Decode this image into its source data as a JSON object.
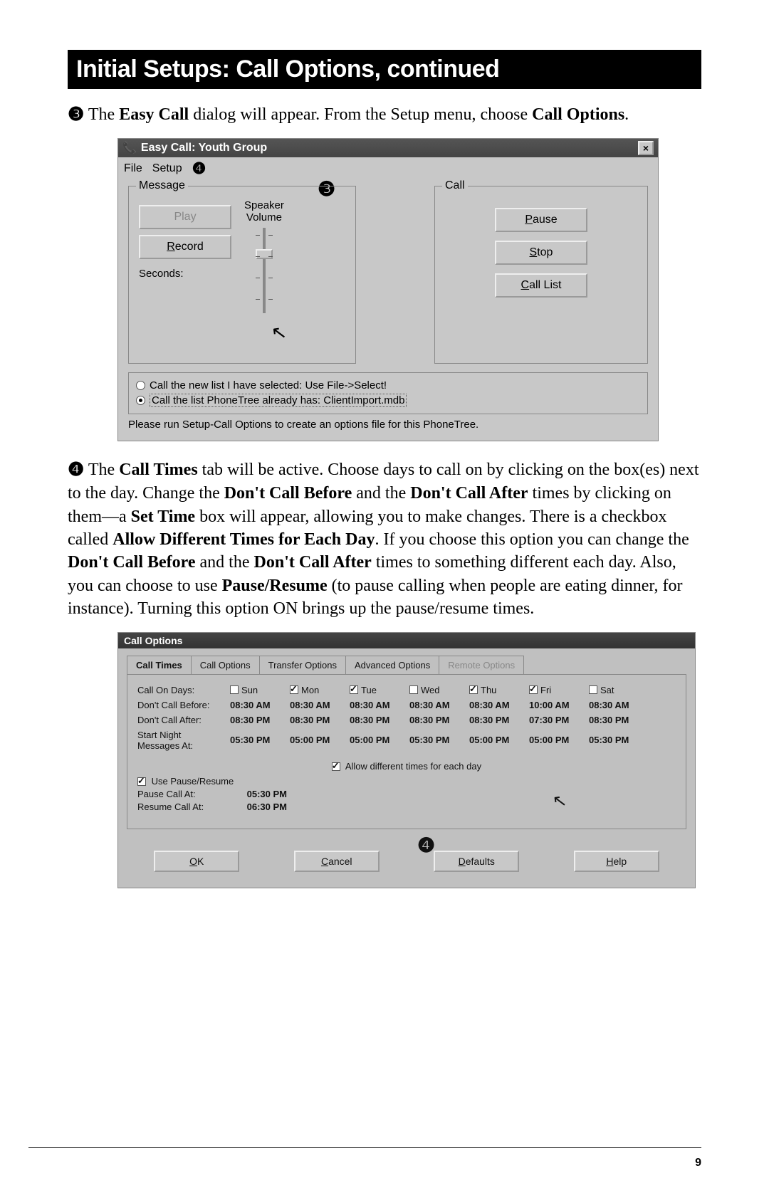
{
  "page": {
    "title": "Initial Setups: Call Options, continued",
    "number": "9"
  },
  "step3": {
    "marker": "❸",
    "text_pre": " The ",
    "b1": "Easy Call",
    "text_mid": " dialog will appear. From the Setup menu, choose ",
    "b2": "Call Options",
    "text_post": "."
  },
  "easycall": {
    "window_title": "Easy Call:  Youth Group",
    "menu_file": "File",
    "menu_setup": "Setup",
    "annot_setup": "❹",
    "annot_body": "❸",
    "group_message": "Message",
    "group_call": "Call",
    "btn_play": "Play",
    "btn_record": "Record",
    "label_seconds": "Seconds:",
    "label_speaker": "Speaker",
    "label_volume": "Volume",
    "btn_pause": "Pause",
    "btn_stop": "Stop",
    "btn_calllist": "Call List",
    "radio1": "Call the new list I have selected: Use File->Select!",
    "radio2": "Call the list PhoneTree already has: ClientImport.mdb",
    "status": "Please run Setup-Call Options to create an options file for this PhoneTree."
  },
  "step4": {
    "marker": "❹",
    "seg1a": " The ",
    "b1": "Call Times",
    "seg1b": " tab will be active. Choose days to call on by clicking on the box(es) next to the day. Change the ",
    "b2": "Don't Call Before",
    "seg2": " and the ",
    "b3": "Don't Call After",
    "seg3": " times by clicking on them—a ",
    "b4": "Set Time",
    "seg4": " box will appear, allowing you to make changes. There is a checkbox called ",
    "b5": "Allow Different Times for Each Day",
    "seg5": ". If you choose this option you can change the ",
    "b6": "Don't Call Before",
    "seg6": " and the ",
    "b7": "Don't Call After",
    "seg7": " times to something different each day. Also, you can choose to use ",
    "b8": "Pause/Resume",
    "seg8": " (to pause calling when people are eating dinner, for instance). Turning this option ON brings up the pause/resume times."
  },
  "callopts": {
    "window_title": "Call Options",
    "tabs": {
      "t1": "Call Times",
      "t2": "Call Options",
      "t3": "Transfer Options",
      "t4": "Advanced Options",
      "t5": "Remote Options"
    },
    "row_labels": {
      "callon": "Call On Days:",
      "before": "Don't Call Before:",
      "after": "Don't Call After:",
      "night1": "Start Night",
      "night2": "Messages At:"
    },
    "days": [
      "Sun",
      "Mon",
      "Tue",
      "Wed",
      "Thu",
      "Fri",
      "Sat"
    ],
    "days_checked": [
      false,
      true,
      true,
      false,
      true,
      true,
      false
    ],
    "before": [
      "08:30 AM",
      "08:30 AM",
      "08:30 AM",
      "08:30 AM",
      "08:30 AM",
      "10:00 AM",
      "08:30 AM"
    ],
    "after": [
      "08:30 PM",
      "08:30 PM",
      "08:30 PM",
      "08:30 PM",
      "08:30 PM",
      "07:30 PM",
      "08:30 PM"
    ],
    "night": [
      "05:30 PM",
      "05:00 PM",
      "05:00 PM",
      "05:30 PM",
      "05:00 PM",
      "05:00 PM",
      "05:30 PM"
    ],
    "allow_label": "Allow different times for each day",
    "usepr_label": "Use Pause/Resume",
    "pause_label": "Pause Call At:",
    "pause_val": "05:30 PM",
    "resume_label": "Resume Call At:",
    "resume_val": "06:30 PM",
    "annot": "❹",
    "btn_ok": "OK",
    "btn_cancel": "Cancel",
    "btn_defaults": "Defaults",
    "btn_help": "Help"
  }
}
